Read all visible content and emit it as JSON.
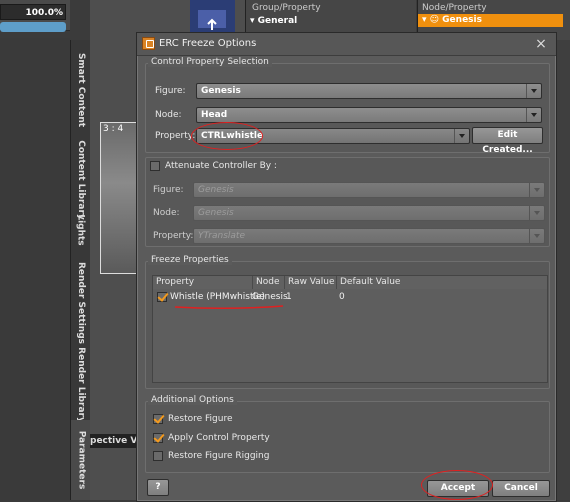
{
  "background": {
    "zoom": "100.0%",
    "viewport_ratio": "3 : 4",
    "viewport_label": "pective Vi",
    "vertical_tabs": [
      "Smart Content",
      "Content Library",
      "Lights",
      "Render Settings",
      "Render Library",
      "Parameters"
    ],
    "group_panel": {
      "title": "Group/Property",
      "row": "General"
    },
    "node_panel": {
      "title": "Node/Property",
      "row": "Genesis"
    }
  },
  "dialog": {
    "title": "ERC Freeze Options",
    "control_property_selection": {
      "title": "Control Property Selection",
      "figure_label": "Figure:",
      "figure_value": "Genesis",
      "node_label": "Node:",
      "node_value": "Head",
      "property_label": "Property:",
      "property_value": "CTRLwhistle",
      "edit_button": "Edit Created..."
    },
    "attenuate": {
      "label": "Attenuate Controller By :",
      "figure_label": "Figure:",
      "figure_value": "Genesis",
      "node_label": "Node:",
      "node_value": "Genesis",
      "property_label": "Property:",
      "property_value": "YTranslate"
    },
    "freeze_properties": {
      "title": "Freeze Properties",
      "columns": [
        "Property",
        "Node",
        "Raw Value",
        "Default Value"
      ],
      "rows": [
        {
          "checked": true,
          "property": "Whistle (PHMwhistle)",
          "node": "Genesis",
          "raw_value": "1",
          "default_value": "0"
        }
      ]
    },
    "additional_options": {
      "title": "Additional Options",
      "items": [
        {
          "label": "Restore Figure",
          "checked": true
        },
        {
          "label": "Apply Control Property",
          "checked": true
        },
        {
          "label": "Restore Figure Rigging",
          "checked": false
        }
      ]
    },
    "help_button": "?",
    "accept_button": "Accept",
    "cancel_button": "Cancel"
  },
  "colors": {
    "accent": "#f0900e",
    "annotation": "#e02020"
  }
}
